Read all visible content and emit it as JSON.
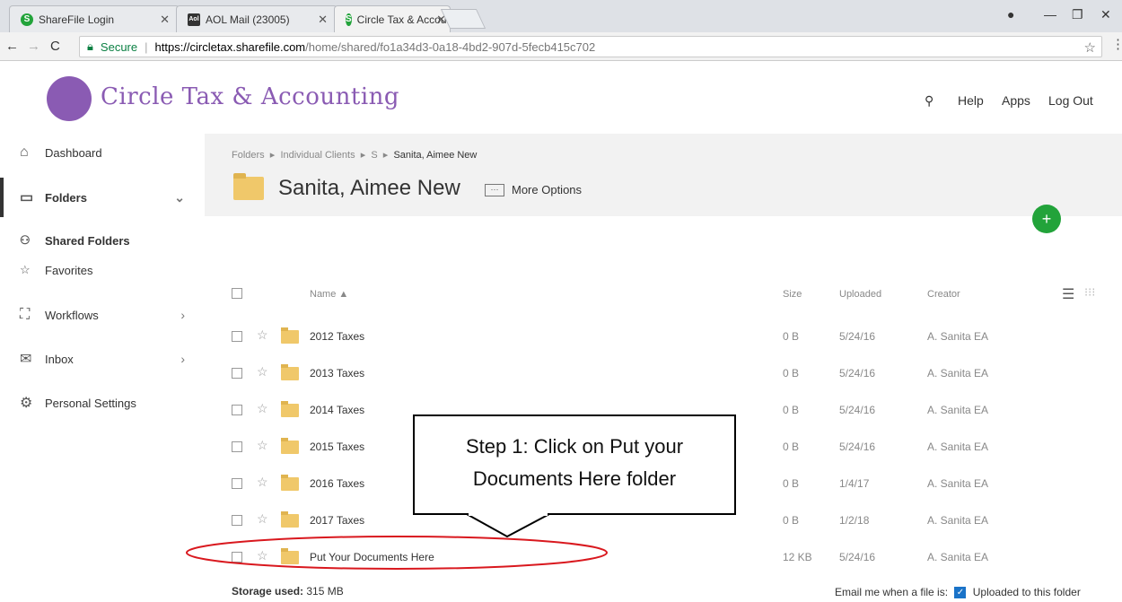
{
  "browser": {
    "tabs": [
      {
        "title": "ShareFile Login",
        "favicon": "sharefile-icon",
        "color": "#22a33a"
      },
      {
        "title": "AOL Mail (23005)",
        "favicon": "aol-icon",
        "color": "#333333"
      },
      {
        "title": "Circle Tax & Accounting",
        "favicon": "sharefile-icon",
        "color": "#22a33a"
      }
    ],
    "secure_label": "Secure",
    "url_host": "https://circletax.sharefile.com",
    "url_path": "/home/shared/fo1a34d3-0a18-4bd2-907d-5fecb415c702"
  },
  "header": {
    "logo_text": "Circle Tax & Accounting",
    "help": "Help",
    "apps": "Apps",
    "logout": "Log Out"
  },
  "sidebar": {
    "items": [
      {
        "label": "Dashboard"
      },
      {
        "label": "Folders"
      },
      {
        "label": "Shared Folders"
      },
      {
        "label": "Favorites"
      },
      {
        "label": "Workflows"
      },
      {
        "label": "Inbox"
      },
      {
        "label": "Personal Settings"
      }
    ]
  },
  "main": {
    "breadcrumb": [
      "Folders",
      "Individual Clients",
      "S",
      "Sanita, Aimee New"
    ],
    "title": "Sanita, Aimee New",
    "more_options": "More Options",
    "columns": {
      "name": "Name ▲",
      "size": "Size",
      "uploaded": "Uploaded",
      "creator": "Creator"
    },
    "rows": [
      {
        "name": "2012 Taxes",
        "size": "0 B",
        "uploaded": "5/24/16",
        "creator": "A. Sanita EA"
      },
      {
        "name": "2013 Taxes",
        "size": "0 B",
        "uploaded": "5/24/16",
        "creator": "A. Sanita EA"
      },
      {
        "name": "2014 Taxes",
        "size": "0 B",
        "uploaded": "5/24/16",
        "creator": "A. Sanita EA"
      },
      {
        "name": "2015 Taxes",
        "size": "0 B",
        "uploaded": "5/24/16",
        "creator": "A. Sanita EA"
      },
      {
        "name": "2016 Taxes",
        "size": "0 B",
        "uploaded": "1/4/17",
        "creator": "A. Sanita EA"
      },
      {
        "name": "2017 Taxes",
        "size": "0 B",
        "uploaded": "1/2/18",
        "creator": "A. Sanita EA"
      },
      {
        "name": "Put Your Documents Here",
        "size": "12 KB",
        "uploaded": "5/24/16",
        "creator": "A. Sanita EA"
      }
    ],
    "storage_label": "Storage used:",
    "storage_value": "315 MB",
    "email_label": "Email me when a file is:",
    "email_option": "Uploaded to this folder"
  },
  "annotation": {
    "line1": "Step 1:  Click on Put your",
    "line2": "Documents Here folder",
    "highlight_color": "#d9181e"
  }
}
